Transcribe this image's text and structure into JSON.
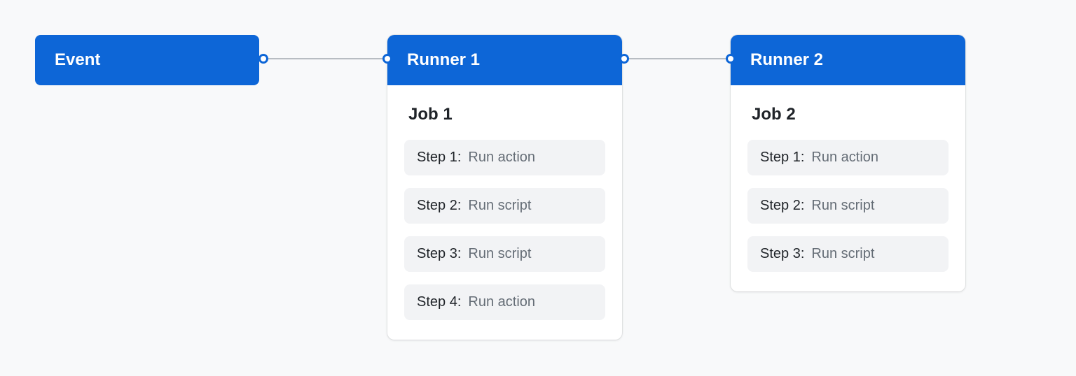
{
  "event": {
    "label": "Event"
  },
  "runners": [
    {
      "title": "Runner 1",
      "job": "Job 1",
      "steps": [
        {
          "label": "Step 1:",
          "action": "Run action"
        },
        {
          "label": "Step 2:",
          "action": "Run script"
        },
        {
          "label": "Step 3:",
          "action": "Run script"
        },
        {
          "label": "Step 4:",
          "action": "Run action"
        }
      ]
    },
    {
      "title": "Runner 2",
      "job": "Job 2",
      "steps": [
        {
          "label": "Step 1:",
          "action": "Run action"
        },
        {
          "label": "Step 2:",
          "action": "Run script"
        },
        {
          "label": "Step 3:",
          "action": "Run script"
        }
      ]
    }
  ]
}
